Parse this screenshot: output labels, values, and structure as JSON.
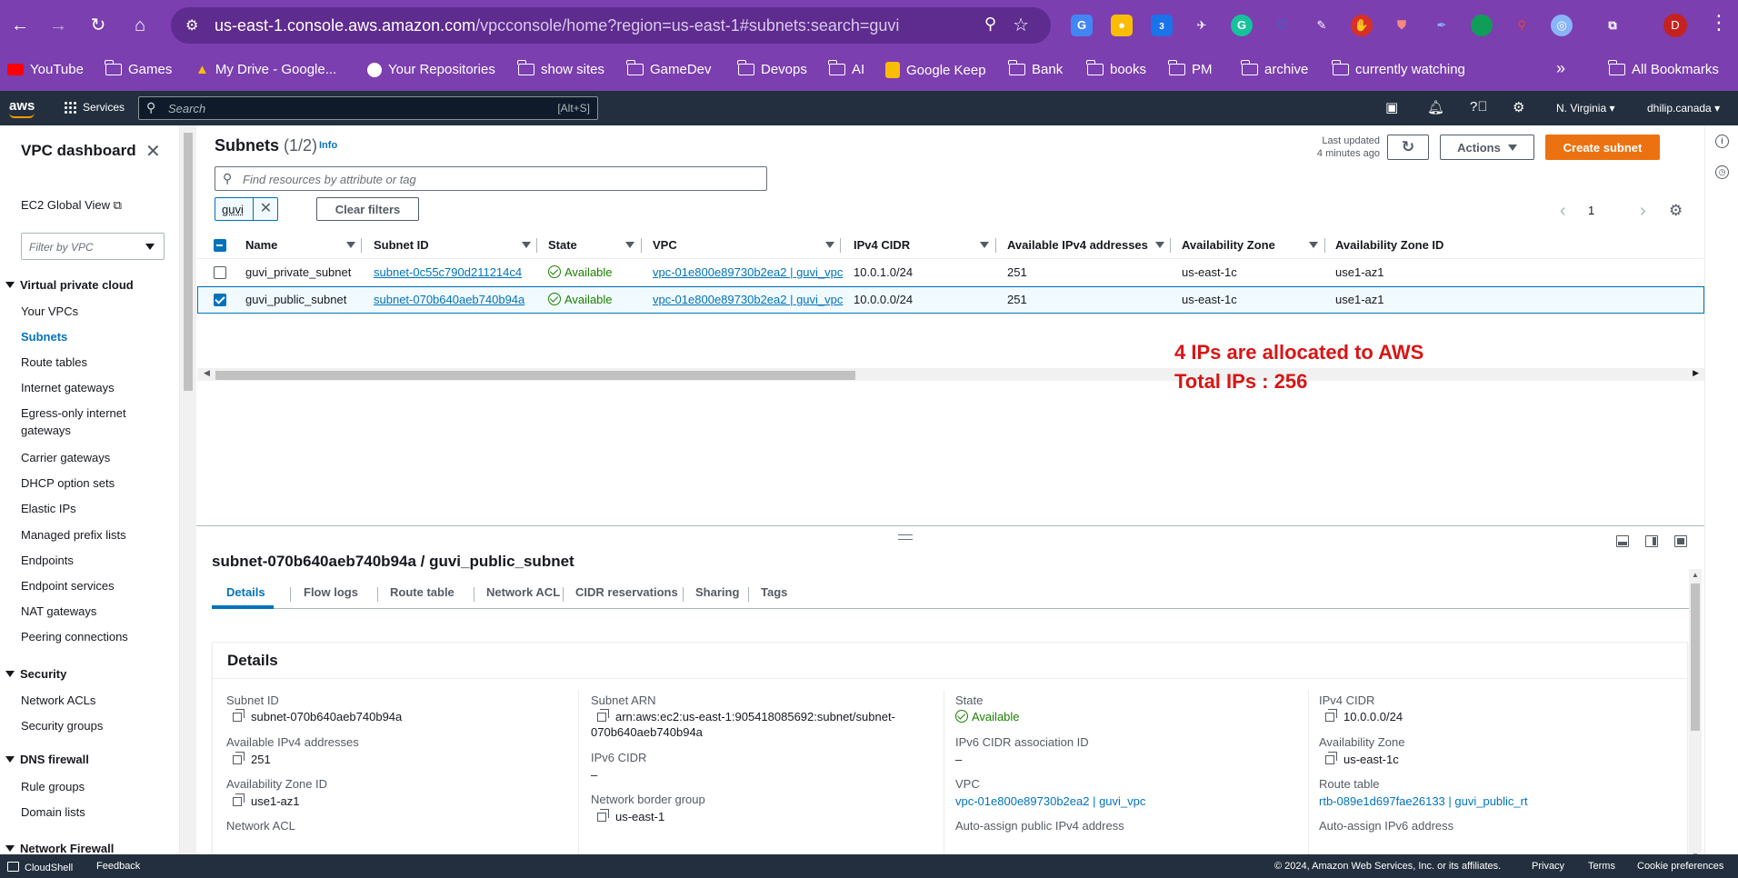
{
  "browser": {
    "url_host": "us-east-1.console.aws.amazon.com",
    "url_path": "/vpcconsole/home?region=us-east-1#subnets:search=guvi",
    "profile_initial": "D",
    "extension_badge": "3",
    "bookmarks": [
      "YouTube",
      "Games",
      "My Drive - Google...",
      "Your Repositories",
      "show sites",
      "GameDev",
      "Devops",
      "AI",
      "Google Keep",
      "Bank",
      "books",
      "PM",
      "archive",
      "currently watching"
    ],
    "all_bookmarks": "All Bookmarks",
    "more_bookmarks": "»"
  },
  "aws": {
    "logo": "aws",
    "services": "Services",
    "search_placeholder": "Search",
    "search_shortcut": "[Alt+S]",
    "region": "N. Virginia",
    "account": "dhilip.canada"
  },
  "sidebar": {
    "title": "VPC dashboard",
    "ec2_global_view": "EC2 Global View",
    "filter_placeholder": "Filter by VPC",
    "sections": {
      "vpc": "Virtual private cloud",
      "security": "Security",
      "dns_firewall": "DNS firewall",
      "network_firewall": "Network Firewall"
    },
    "vpc_items": [
      "Your VPCs",
      "Subnets",
      "Route tables",
      "Internet gateways",
      "Egress-only internet",
      "gateways",
      "Carrier gateways",
      "DHCP option sets",
      "Elastic IPs",
      "Managed prefix lists",
      "Endpoints",
      "Endpoint services",
      "NAT gateways",
      "Peering connections"
    ],
    "security_items": [
      "Network ACLs",
      "Security groups"
    ],
    "dns_items": [
      "Rule groups",
      "Domain lists"
    ]
  },
  "panel": {
    "title": "Subnets",
    "count": "(1/2)",
    "info": "Info",
    "last_updated_1": "Last updated",
    "last_updated_2": "4 minutes ago",
    "actions": "Actions",
    "create_subnet": "Create subnet",
    "search_placeholder": "Find resources by attribute or tag",
    "filter_token": "guvi",
    "clear_filters": "Clear filters",
    "page": "1"
  },
  "table": {
    "columns": [
      "Name",
      "Subnet ID",
      "State",
      "VPC",
      "IPv4 CIDR",
      "Available IPv4 addresses",
      "Availability Zone",
      "Availability Zone ID"
    ],
    "rows": [
      {
        "name": "guvi_private_subnet",
        "subnet_id": "subnet-0c55c790d211214c4",
        "state": "Available",
        "vpc": "vpc-01e800e89730b2ea2 | guvi_vpc",
        "cidr": "10.0.1.0/24",
        "available": "251",
        "az": "us-east-1c",
        "az_id": "use1-az1",
        "selected": false
      },
      {
        "name": "guvi_public_subnet",
        "subnet_id": "subnet-070b640aeb740b94a",
        "state": "Available",
        "vpc": "vpc-01e800e89730b2ea2 | guvi_vpc",
        "cidr": "10.0.0.0/24",
        "available": "251",
        "az": "us-east-1c",
        "az_id": "use1-az1",
        "selected": true
      }
    ]
  },
  "annotation": {
    "line1": "4 IPs are allocated to AWS",
    "line2": "Total IPs : 256"
  },
  "details": {
    "title": "subnet-070b640aeb740b94a / guvi_public_subnet",
    "tabs": [
      "Details",
      "Flow logs",
      "Route table",
      "Network ACL",
      "CIDR reservations",
      "Sharing",
      "Tags"
    ],
    "card_title": "Details",
    "subnet_id_label": "Subnet ID",
    "subnet_id": "subnet-070b640aeb740b94a",
    "available_label": "Available IPv4 addresses",
    "available": "251",
    "az_id_label": "Availability Zone ID",
    "az_id": "use1-az1",
    "nacl_label": "Network ACL",
    "arn_label": "Subnet ARN",
    "arn_line1": "arn:aws:ec2:us-east-1:905418085692:subnet/subnet-",
    "arn_line2": "070b640aeb740b94a",
    "ipv6_label": "IPv6 CIDR",
    "ipv6": "–",
    "nbg_label": "Network border group",
    "nbg": "us-east-1",
    "state_label": "State",
    "state": "Available",
    "ipv6_assoc_label": "IPv6 CIDR association ID",
    "ipv6_assoc": "–",
    "vpc_label": "VPC",
    "vpc": "vpc-01e800e89730b2ea2 | guvi_vpc",
    "auto_ipv4_label": "Auto-assign public IPv4 address",
    "ipv4_cidr_label": "IPv4 CIDR",
    "ipv4_cidr": "10.0.0.0/24",
    "az_label": "Availability Zone",
    "az": "us-east-1c",
    "route_table_label": "Route table",
    "route_table": "rtb-089e1d697fae26133 | guvi_public_rt",
    "auto_ipv6_label": "Auto-assign IPv6 address"
  },
  "footer": {
    "cloudshell": "CloudShell",
    "feedback": "Feedback",
    "copyright": "© 2024, Amazon Web Services, Inc. or its affiliates.",
    "privacy": "Privacy",
    "terms": "Terms",
    "cookies": "Cookie preferences"
  },
  "colors": {
    "browser_chrome": "#7b3fb0",
    "aws_header": "#232f3e",
    "link": "#0073bb",
    "primary_button": "#ec7211",
    "success": "#1d8102",
    "annotation": "#d91515"
  }
}
